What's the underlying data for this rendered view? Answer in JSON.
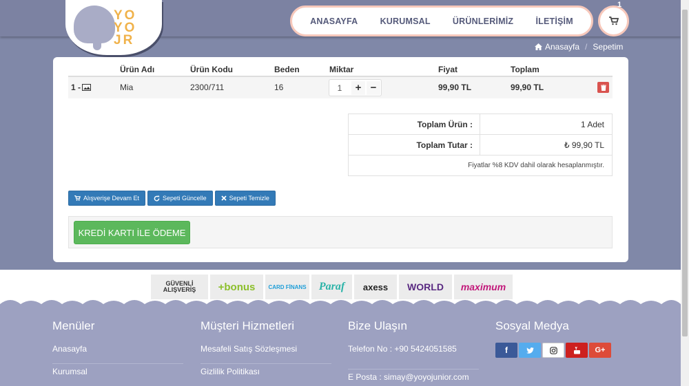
{
  "header": {
    "logo_letters": [
      "YO",
      "YO",
      "JR"
    ],
    "nav": [
      "ANASAYFA",
      "KURUMSAL",
      "ÜRÜNLERİMİZ",
      "İLETİŞİM"
    ],
    "cart_count": "1"
  },
  "breadcrumb": {
    "home": "Anasayfa",
    "sep": "/",
    "current": "Sepetim"
  },
  "table": {
    "headers": {
      "name": "Ürün Adı",
      "code": "Ürün Kodu",
      "size": "Beden",
      "qty": "Miktar",
      "price": "Fiyat",
      "total": "Toplam"
    },
    "rows": [
      {
        "index": "1 -",
        "name": "Mia",
        "code": "2300/711",
        "size": "16",
        "qty": "1",
        "price": "99,90 TL",
        "total": "99,90 TL"
      }
    ]
  },
  "summary": {
    "total_items_label": "Toplam Ürün :",
    "total_items_value": "1 Adet",
    "total_amount_label": "Toplam Tutar :",
    "total_amount_value": "₺ 99,90 TL",
    "vat_note": "Fiyatlar %8 KDV dahil olarak hesaplanmıştır."
  },
  "actions": {
    "continue": "Alışverişe Devam Et",
    "update": "Sepeti Güncelle",
    "clear": "Sepeti Temizle"
  },
  "payment": {
    "credit_card": "KREDİ KARTI İLE ÖDEME"
  },
  "bank_logos": [
    "GÜVENLİ ALIŞVERİŞ",
    "+bonus",
    "CARD FİNANS",
    "Paraf",
    "axess",
    "WORLD",
    "maximum"
  ],
  "footer": {
    "menus": {
      "title": "Menüler",
      "links": [
        "Anasayfa",
        "Kurumsal"
      ]
    },
    "customer": {
      "title": "Müşteri Hizmetleri",
      "links": [
        "Mesafeli Satış Sözleşmesi",
        "Gizlilik Politikası"
      ]
    },
    "contact": {
      "title": "Bize Ulaşın",
      "phone": "Telefon No : +90 5424051585",
      "email": "E Posta : simay@yoyojunior.com"
    },
    "social": {
      "title": "Sosyal Medya"
    }
  },
  "colors": {
    "header_bg": "#7c82a2",
    "accent_pink": "#f7c8bb",
    "primary": "#337ab7",
    "success": "#5cb85c",
    "danger": "#d9534f"
  }
}
